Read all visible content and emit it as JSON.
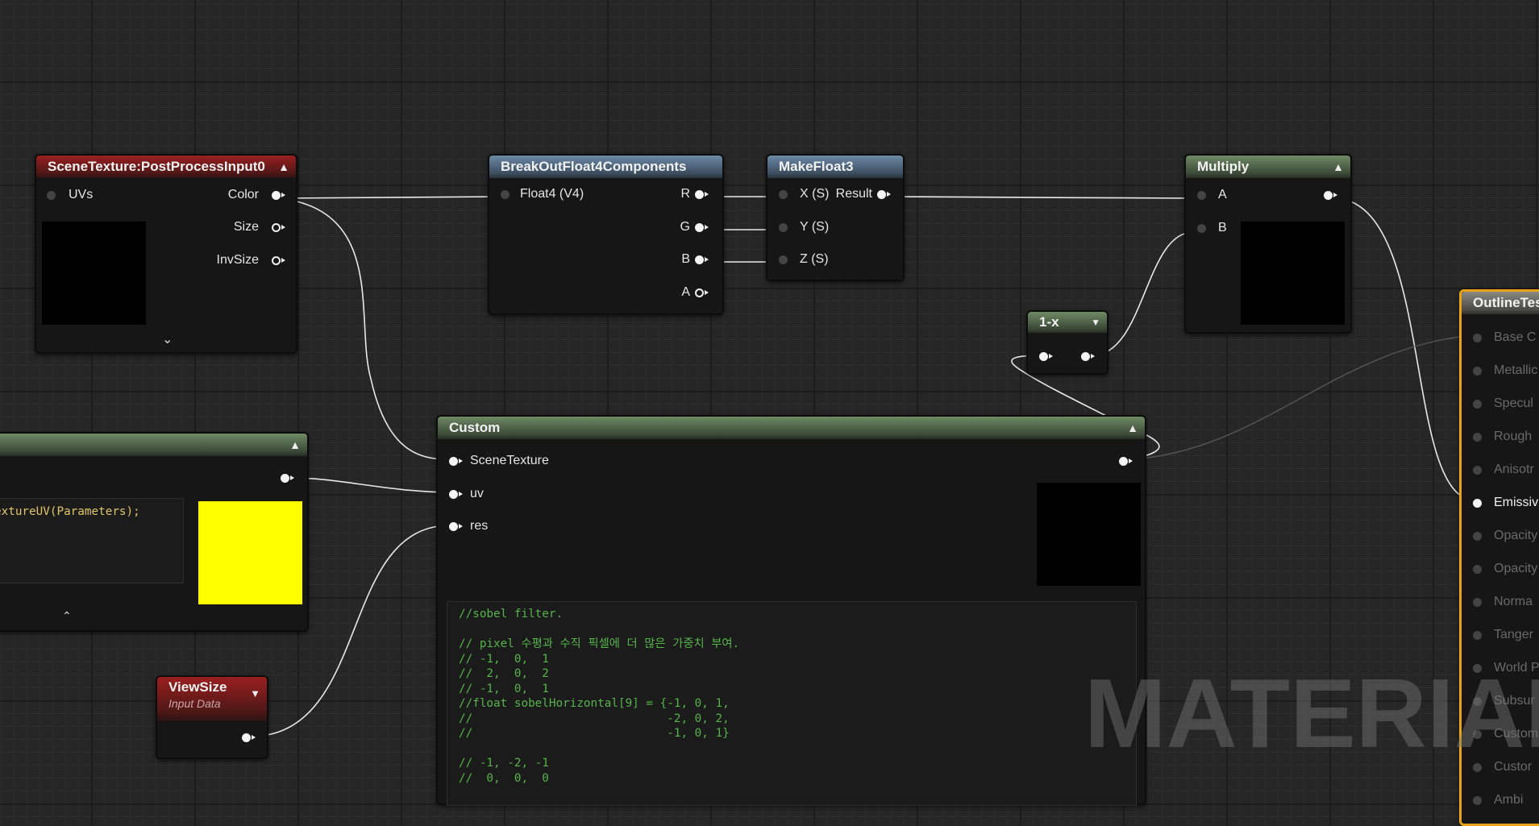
{
  "nodes": {
    "scene_texture": {
      "title": "SceneTexture:PostProcessInput0",
      "inputs": [
        "UVs"
      ],
      "outputs": [
        "Color",
        "Size",
        "InvSize"
      ]
    },
    "break_out": {
      "title": "BreakOutFloat4Components",
      "inputs": [
        "Float4 (V4)"
      ],
      "outputs": [
        "R",
        "G",
        "B",
        "A"
      ]
    },
    "make_float3": {
      "title": "MakeFloat3",
      "inputs": [
        "X (S)",
        "Y (S)",
        "Z (S)"
      ],
      "outputs": [
        "Result"
      ]
    },
    "multiply": {
      "title": "Multiply",
      "inputs": [
        "A",
        "B"
      ]
    },
    "one_minus": {
      "title": "1-x"
    },
    "custom": {
      "title": "Custom",
      "inputs": [
        "SceneTexture",
        "uv",
        "res"
      ],
      "code": "//sobel filter.\n\n// pixel 수평과 수직 픽셀에 더 많은 가중치 부여.\n// -1,  0,  1\n//  2,  0,  2\n// -1,  0,  1\n//float sobelHorizontal[9] = {-1, 0, 1,\n//                            -2, 0, 2,\n//                            -1, 0, 1}\n\n// -1, -2, -1\n//  0,  0,  0"
    },
    "left_custom": {
      "code": "extureUV(Parameters);",
      "preview_color": "#ffff00"
    },
    "view_size": {
      "title": "ViewSize",
      "subtitle": "Input Data"
    },
    "outline": {
      "title": "OutlineTes",
      "inputs": [
        "Base C",
        "Metallic",
        "Specul",
        "Rough",
        "Anisotr",
        "Emissiv",
        "Opacity",
        "Opacity",
        "Norma",
        "Tanger",
        "World P",
        "Subsur",
        "Custom",
        "Custor",
        "Ambi"
      ]
    }
  },
  "watermark": "MATERIAL",
  "colors": {
    "grid_bg": "#262626",
    "selected_border": "#e8a317",
    "custom_code_comment": "#57b34b",
    "custom_code_text": "#e0c56a"
  }
}
